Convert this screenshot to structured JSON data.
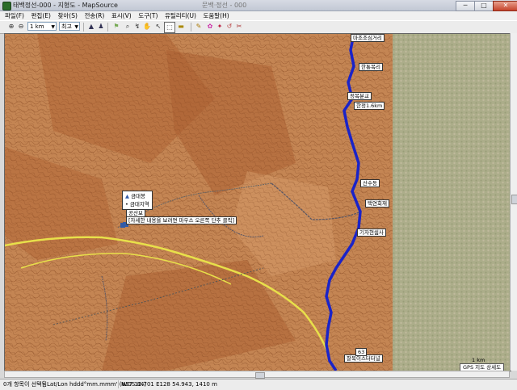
{
  "window": {
    "title": "태백정선-000 - 지형도 - MapSource",
    "center_title": "문백·정선 - 000"
  },
  "window_buttons": {
    "minimize": "─",
    "maximize": "□",
    "close": "✕"
  },
  "menu": [
    "파일(F)",
    "편집(E)",
    "찾아(S)",
    "전송(R)",
    "표시(V)",
    "도구(T)",
    "유틸리티(U)",
    "도움말(H)"
  ],
  "toolbar": {
    "zoom_value": "1 km",
    "detail_value": "최고",
    "icons": [
      "zoom-in-icon",
      "zoom-out-icon",
      "mountain-icon",
      "person-icon",
      "flag-icon",
      "magnifier-icon",
      "hand-icon",
      "selection-icon",
      "route-icon",
      "measure-icon",
      "ruler-icon",
      "waypoint-icon",
      "edit-icon",
      "tracks-icon",
      "undo-icon",
      "erase-icon"
    ]
  },
  "map": {
    "labels": [
      {
        "id": "label-top",
        "text": "마조조심거리"
      },
      {
        "id": "label-2",
        "text": "한통목리"
      },
      {
        "id": "label-3",
        "text": "정목분교"
      },
      {
        "id": "label-4",
        "text": "한정1.6km"
      },
      {
        "id": "label-5",
        "text": "산수동"
      },
      {
        "id": "label-6",
        "text": "택연회재"
      },
      {
        "id": "label-7",
        "text": "기자현쉼사"
      },
      {
        "id": "label-8",
        "text": "잘목이스터터널"
      },
      {
        "id": "label-9",
        "text": "63"
      }
    ],
    "popup": {
      "line1": "금대봉",
      "line2": "금대지역",
      "line3": "공산보",
      "line4": "[자세한 내용을 보려면 마우스 오른쪽 단추 클릭]"
    },
    "scale_text": "1 km",
    "gps_text": "GPS 지도 상세도"
  },
  "status": {
    "selection": "0개 항목이 선택됨",
    "format": "Lat/Lon hddd°mm.mmm' (WGS 84)",
    "coordinates": "N37 12.701 E128 54.943, 1410 m"
  },
  "colors": {
    "terrain_dark": "#b86a3a",
    "terrain_light": "#c9915f",
    "satellite_green": "#a7ab85",
    "route_blue": "#1a23c8",
    "road_yellow": "#e8e04a"
  }
}
